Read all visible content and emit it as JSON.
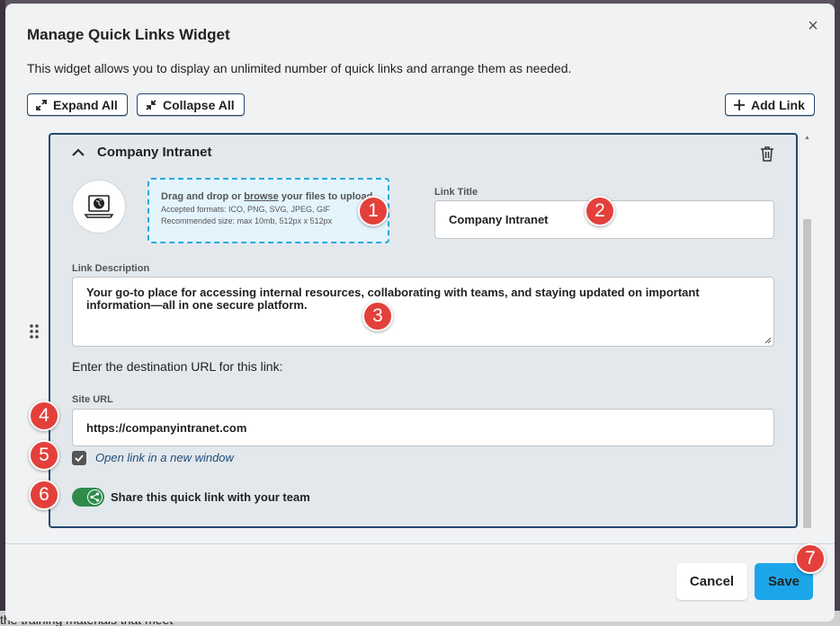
{
  "modal": {
    "title": "Manage Quick Links Widget",
    "description": "This widget allows you to display an unlimited number of quick links and arrange them as needed.",
    "close_glyph": "×"
  },
  "toolbar": {
    "expand_all": "Expand All",
    "collapse_all": "Collapse All",
    "add_link": "Add Link"
  },
  "link_card": {
    "title": "Company Intranet",
    "upload": {
      "line1_prefix": "Drag and drop or ",
      "line1_link": "browse",
      "line1_suffix": " your files to upload",
      "accepted_formats": "Accepted formats: ICO, PNG, SVG, JPEG, GIF",
      "recommended_size": "Recommended size: max 10mb, 512px x 512px"
    },
    "link_title_label": "Link Title",
    "link_title_value": "Company Intranet",
    "description_label": "Link Description",
    "description_value": "Your go-to place for accessing internal resources, collaborating with teams, and staying updated on important information—all in one secure platform.",
    "destination_prompt": "Enter the destination URL for this link:",
    "site_url_label": "Site URL",
    "site_url_value": "https://companyintranet.com",
    "open_new_window_label": "Open link in a new window",
    "open_new_window_checked": true,
    "share_label": "Share this quick link with your team",
    "share_enabled": true
  },
  "footer": {
    "cancel": "Cancel",
    "save": "Save"
  },
  "markers": [
    "1",
    "2",
    "3",
    "4",
    "5",
    "6",
    "7"
  ],
  "background_text": "the training materials that meet",
  "colors": {
    "accent_blue": "#1ca6ea",
    "card_border": "#244a6e",
    "toggle_green": "#2e8b4b",
    "marker_red": "#e3403b",
    "dropzone_border": "#22aadd"
  }
}
